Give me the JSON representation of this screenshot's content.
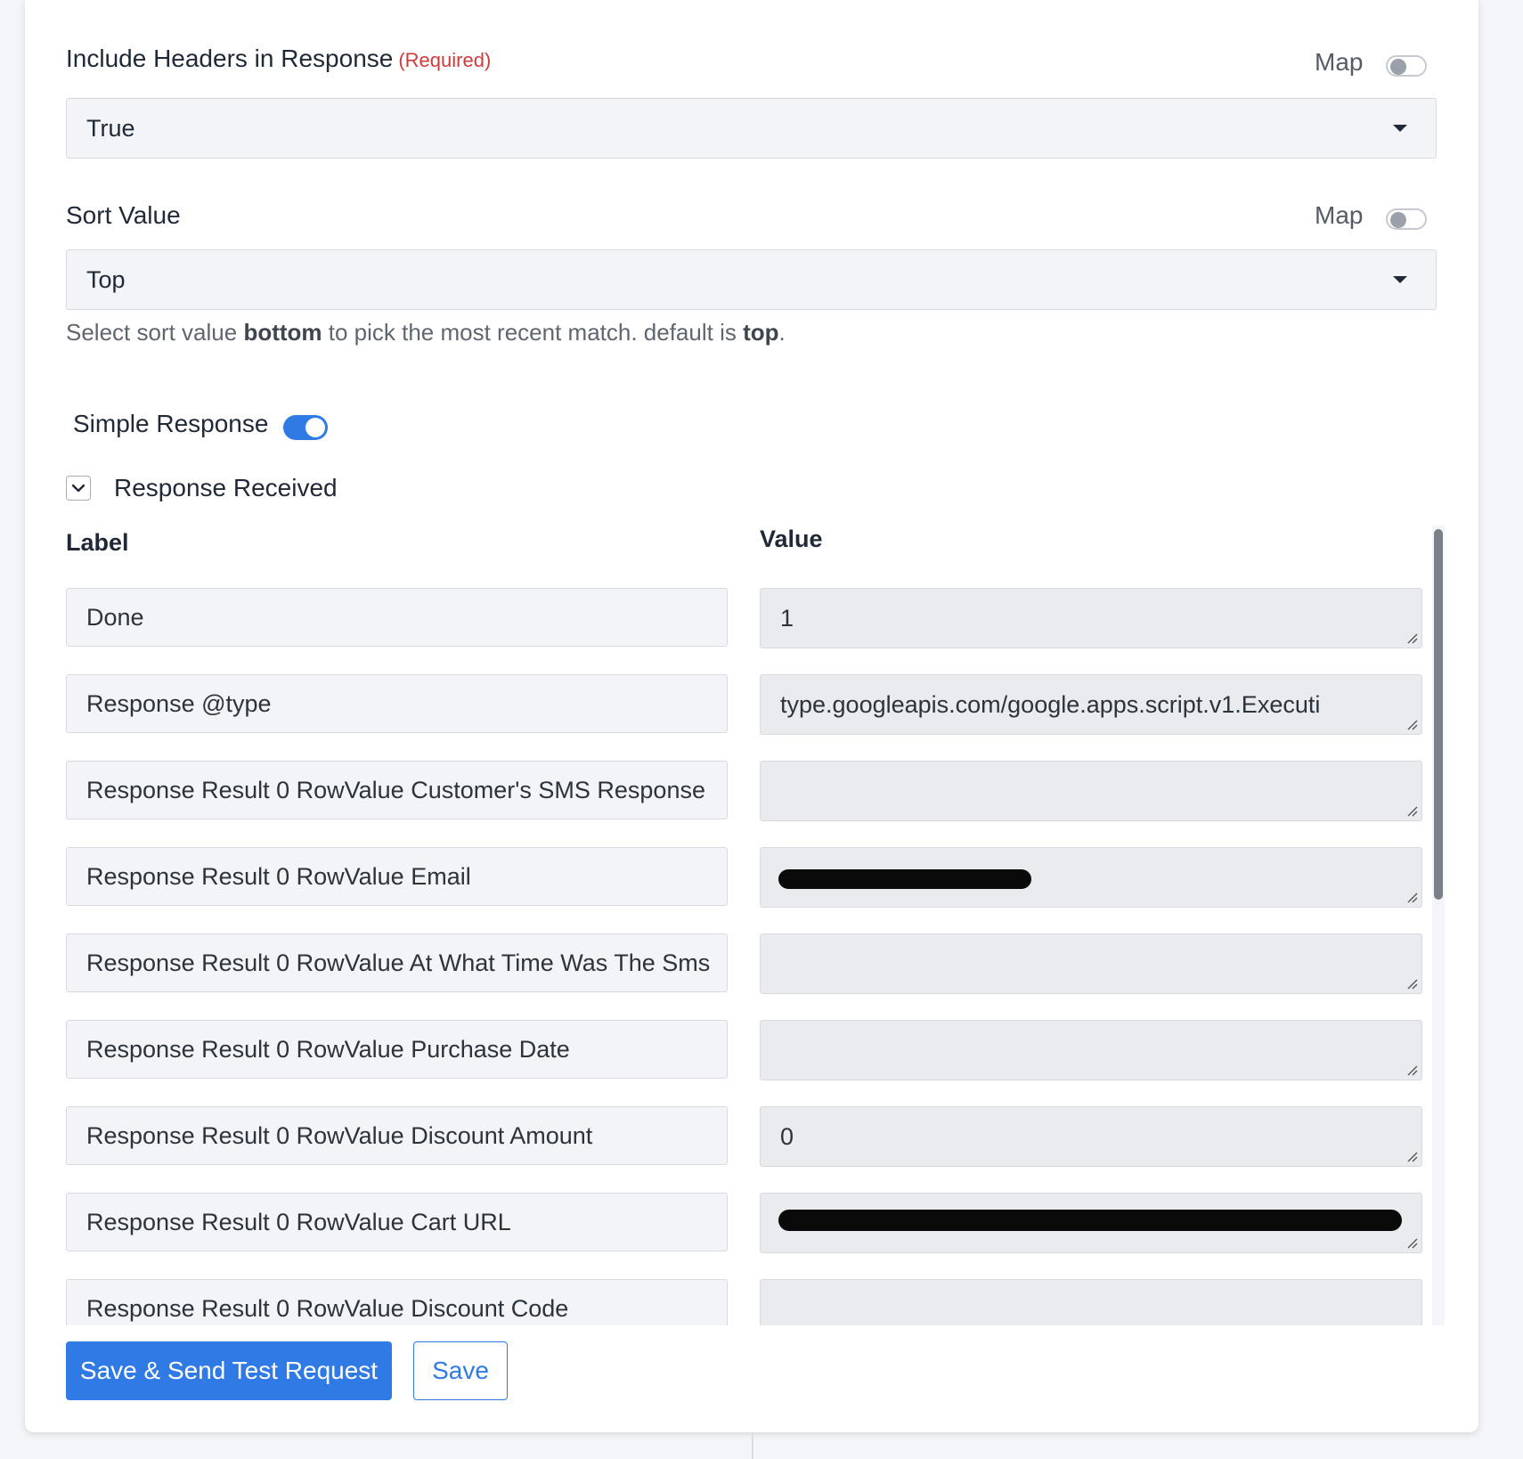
{
  "include_headers": {
    "label": "Include Headers in Response",
    "required_tag": "(Required)",
    "map_label": "Map",
    "selected_value": "True"
  },
  "sort_value": {
    "label": "Sort Value",
    "map_label": "Map",
    "selected_value": "Top",
    "help_prefix": "Select sort value ",
    "help_bold1": "bottom",
    "help_middle": " to pick the most recent match. default is ",
    "help_bold2": "top",
    "help_suffix": "."
  },
  "simple_response": {
    "label": "Simple Response",
    "enabled": true
  },
  "response_received": {
    "label": "Response Received"
  },
  "table": {
    "label_header": "Label",
    "value_header": "Value",
    "rows": [
      {
        "label": "Done",
        "value": "1"
      },
      {
        "label": "Response @type",
        "value": "type.googleapis.com/google.apps.script.v1.Executi"
      },
      {
        "label": "Response Result 0 RowValue Customer's SMS Response",
        "value": ""
      },
      {
        "label": "Response Result 0 RowValue Email",
        "value": ""
      },
      {
        "label": "Response Result 0 RowValue At What Time Was The Sms",
        "value": ""
      },
      {
        "label": "Response Result 0 RowValue Purchase Date",
        "value": ""
      },
      {
        "label": "Response Result 0 RowValue Discount Amount",
        "value": "0"
      },
      {
        "label": "Response Result 0 RowValue Cart URL",
        "value": ""
      },
      {
        "label": "Response Result 0 RowValue Discount Code",
        "value": ""
      }
    ]
  },
  "buttons": {
    "primary": "Save & Send Test Request",
    "secondary": "Save"
  },
  "colors": {
    "accent": "#2f7ae5",
    "required": "#d03a3a"
  }
}
